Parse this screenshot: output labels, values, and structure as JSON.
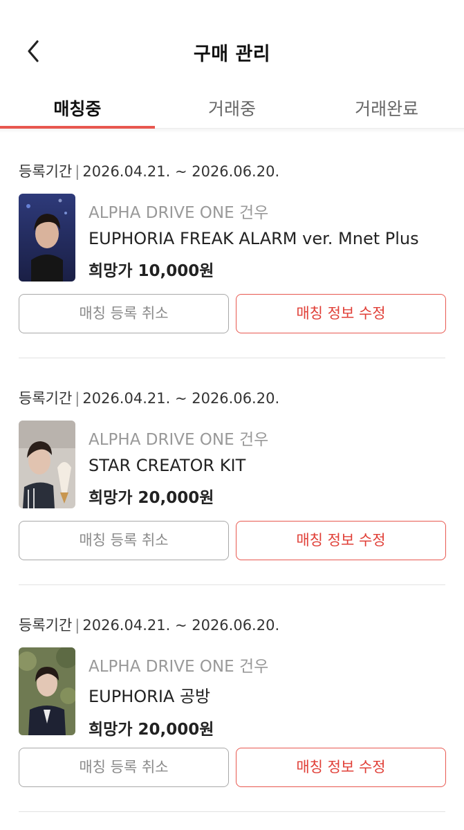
{
  "header": {
    "title": "구매 관리"
  },
  "tabs": [
    {
      "label": "매칭중",
      "active": true
    },
    {
      "label": "거래중",
      "active": false
    },
    {
      "label": "거래완료",
      "active": false
    }
  ],
  "items": [
    {
      "period_label": "등록기간",
      "period_value": "2026.04.21. ~ 2026.06.20.",
      "artist": "ALPHA DRIVE ONE 건우",
      "title": "EUPHORIA FREAK ALARM ver. Mnet Plus",
      "price": "희망가 10,000원",
      "cancel_label": "매칭 등록 취소",
      "edit_label": "매칭 정보 수정"
    },
    {
      "period_label": "등록기간",
      "period_value": "2026.04.21. ~ 2026.06.20.",
      "artist": "ALPHA DRIVE ONE 건우",
      "title": "STAR CREATOR KIT",
      "price": "희망가 20,000원",
      "cancel_label": "매칭 등록 취소",
      "edit_label": "매칭 정보 수정"
    },
    {
      "period_label": "등록기간",
      "period_value": "2026.04.21. ~ 2026.06.20.",
      "artist": "ALPHA DRIVE ONE 건우",
      "title": "EUPHORIA 공방",
      "price": "희망가 20,000원",
      "cancel_label": "매칭 등록 취소",
      "edit_label": "매칭 정보 수정"
    }
  ],
  "colors": {
    "accent": "#e8574f",
    "muted": "#999999"
  },
  "icons": {
    "back": "chevron-left-icon"
  }
}
